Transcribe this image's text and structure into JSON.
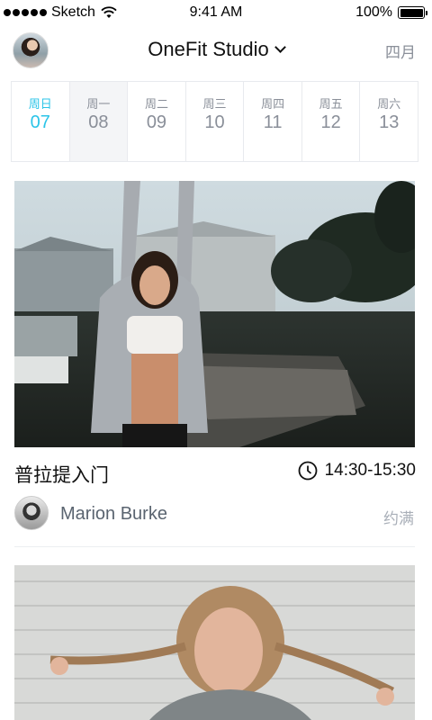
{
  "status_bar": {
    "carrier": "Sketch",
    "time": "9:41 AM",
    "battery": "100%"
  },
  "header": {
    "studio_name": "OneFit Studio",
    "month": "四月"
  },
  "week": [
    {
      "day": "周日",
      "date": "07"
    },
    {
      "day": "周一",
      "date": "08"
    },
    {
      "day": "周二",
      "date": "09"
    },
    {
      "day": "周三",
      "date": "10"
    },
    {
      "day": "周四",
      "date": "11"
    },
    {
      "day": "周五",
      "date": "12"
    },
    {
      "day": "周六",
      "date": "13"
    }
  ],
  "classes": [
    {
      "name": "普拉提入门",
      "time": "14:30-15:30",
      "coach": "Marion Burke",
      "status": "约满"
    }
  ],
  "colors": {
    "accent": "#2bc4e8",
    "muted_text": "#8a8f99",
    "status_text": "#a9afb8"
  }
}
